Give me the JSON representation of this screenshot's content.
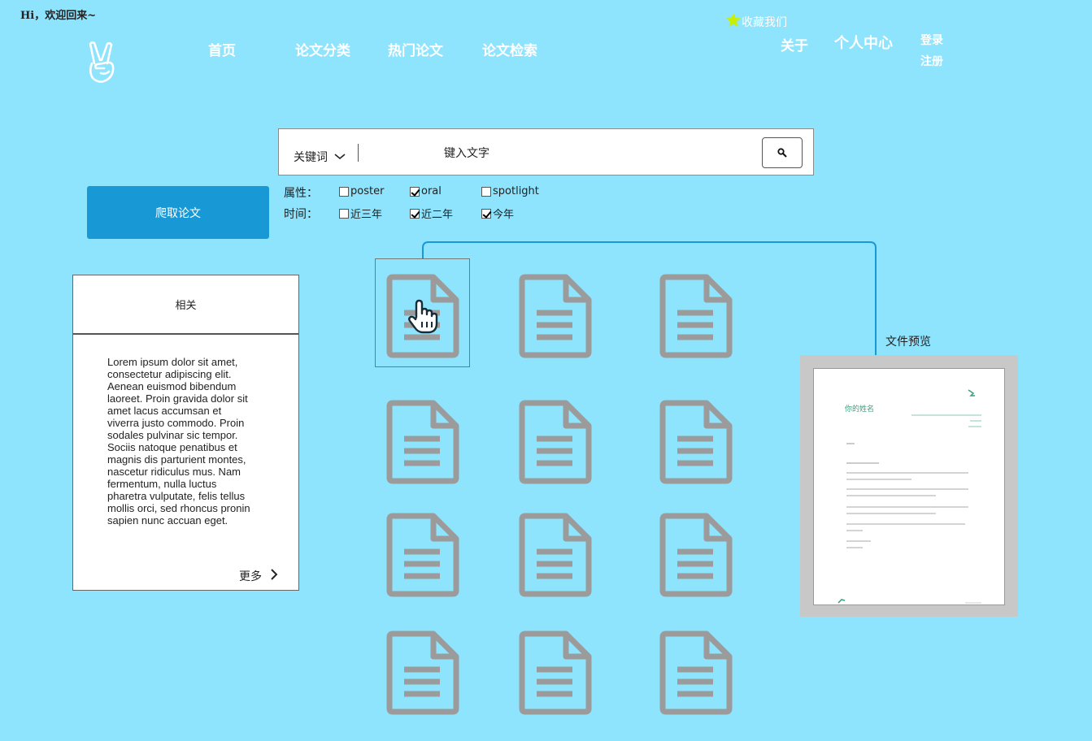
{
  "header": {
    "greeting": "Hi，欢迎回来~",
    "favorite": "收藏我们",
    "nav": [
      "首页",
      "论文分类",
      "热门论文",
      "论文检索"
    ],
    "about": "关于",
    "personal_center": "个人中心",
    "login": "登录",
    "register": "注册"
  },
  "search": {
    "select_label": "关键词",
    "placeholder": "键入文字"
  },
  "crawl_button": "爬取论文",
  "filters": {
    "attr_label": "属性：",
    "attr_options": [
      {
        "label": "poster",
        "checked": false
      },
      {
        "label": "oral",
        "checked": true
      },
      {
        "label": "spotlight",
        "checked": false
      }
    ],
    "time_label": "时间：",
    "time_options": [
      {
        "label": "近三年",
        "checked": false
      },
      {
        "label": "近二年",
        "checked": true
      },
      {
        "label": "今年",
        "checked": true
      }
    ]
  },
  "related": {
    "title": "相关",
    "body": "Lorem ipsum dolor sit amet, consectetur adipiscing elit. Aenean euismod bibendum laoreet. Proin gravida dolor sit amet lacus accumsan et viverra justo commodo. Proin sodales pulvinar sic tempor. Sociis natoque penatibus et magnis dis parturient montes, nascetur ridiculus mus. Nam fermentum, nulla luctus pharetra vulputate, felis tellus mollis orci, sed rhoncus pronin sapien nunc accuan eget.",
    "more": "更多"
  },
  "preview": {
    "label": "文件预览",
    "doc_title": "你的姓名"
  },
  "colors": {
    "background": "#8EE3FD",
    "button": "#1899D5",
    "doc_icon": "#9B9B9B",
    "connector": "#1899D5",
    "star": "#C8F000"
  }
}
